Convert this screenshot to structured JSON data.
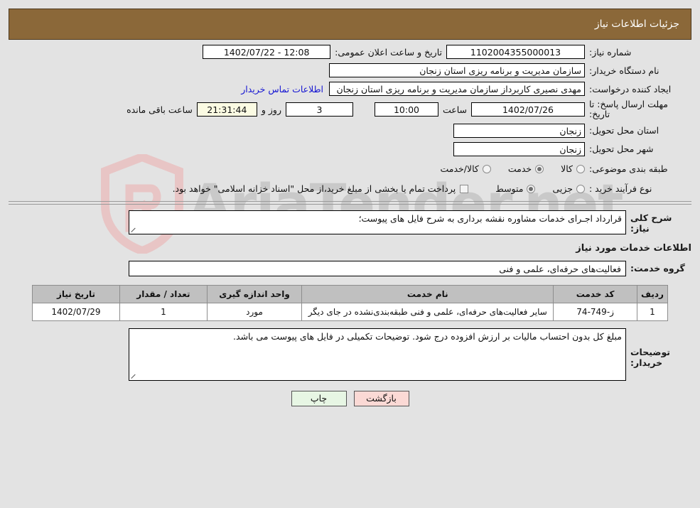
{
  "header": {
    "title": "جزئیات اطلاعات نیاز"
  },
  "form": {
    "need_no_label": "شماره نیاز:",
    "need_no_value": "1102004355000013",
    "public_announce_label": "تاریخ و ساعت اعلان عمومی:",
    "public_announce_value": "12:08 - 1402/07/22",
    "buyer_org_label": "نام دستگاه خریدار:",
    "buyer_org_value": "سازمان مدیریت و برنامه ریزی استان زنجان",
    "creator_label": "ایجاد کننده درخواست:",
    "creator_value": "مهدی نصیری کاربرداز سازمان مدیریت و برنامه ریزی استان زنجان",
    "contact_link": "اطلاعات تماس خریدار",
    "deadline_label": "مهلت ارسال پاسخ: تا تاریخ:",
    "deadline_date": "1402/07/26",
    "deadline_time_label": "ساعت",
    "deadline_time": "10:00",
    "remaining_days": "3",
    "remaining_days_label": "روز و",
    "remaining_countdown": "21:31:44",
    "remaining_suffix": "ساعت باقی مانده",
    "province_label": "استان محل تحویل:",
    "province_value": "زنجان",
    "city_label": "شهر محل تحویل:",
    "city_value": "زنجان",
    "category_label": "طبقه بندی موضوعی:",
    "category_options": [
      {
        "label": "کالا",
        "selected": false
      },
      {
        "label": "خدمت",
        "selected": true
      },
      {
        "label": "کالا/خدمت",
        "selected": false
      }
    ],
    "process_label": "نوع فرآیند خرید :",
    "process_options": [
      {
        "label": "جزیی",
        "selected": false
      },
      {
        "label": "متوسط",
        "selected": true
      }
    ],
    "treasury_checkbox_checked": false,
    "treasury_note": "پرداخت تمام یا بخشی از مبلغ خرید،از محل \"اسناد خزانه اسلامی\" خواهد بود."
  },
  "description": {
    "label": "شرح کلی نیاز:",
    "value": "قرارداد اجـرای خدمات مشاوره نقشه برداری به شرح فایل های پیوست؛"
  },
  "services": {
    "section_title": "اطلاعات خدمات مورد نیاز",
    "group_label": "گروه خدمت:",
    "group_value": "فعالیت‌های حرفه‌ای، علمی و فنی",
    "table": {
      "columns": [
        "ردیف",
        "کد خدمت",
        "نام خدمت",
        "واحد اندازه گیری",
        "تعداد / مقدار",
        "تاریخ نیاز"
      ],
      "rows": [
        {
          "radif": "1",
          "code": "ز-749-74",
          "name": "سایر فعالیت‌های حرفه‌ای، علمی و فنی طبقه‌بندی‌نشده در جای دیگر",
          "unit": "مورد",
          "qty": "1",
          "date": "1402/07/29"
        }
      ]
    }
  },
  "buyer_notes": {
    "label": "توضیحات خریدار:",
    "value": "مبلغ کل بدون احتساب مالیات بر ارزش افزوده درج شود. توضیحات تکمیلی در فایل های پیوست می باشد."
  },
  "footer": {
    "print_label": "چاپ",
    "back_label": "بازگشت"
  },
  "watermark": {
    "text": "AriaTender.net"
  },
  "colors": {
    "header_bg": "#8b6839",
    "page_bg": "#e3e3e3",
    "link": "#1414d2",
    "countdown_bg": "#fbfbe3",
    "table_header_bg": "#c0c0c0",
    "btn_print_bg": "#e7f6e4",
    "btn_back_bg": "#fbd9d5"
  }
}
